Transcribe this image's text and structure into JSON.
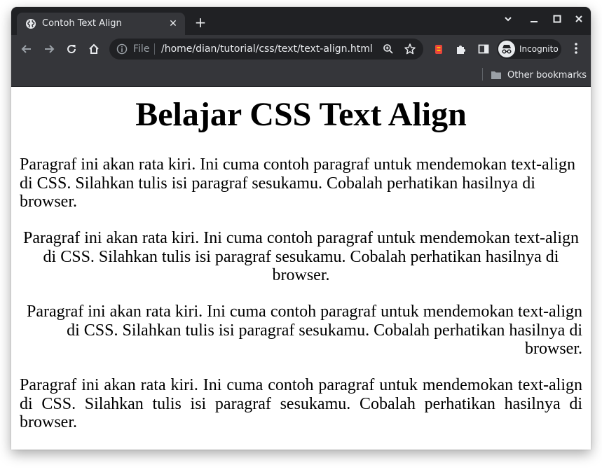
{
  "browser": {
    "tab": {
      "title": "Contoh Text Align",
      "favicon": "globe-icon"
    },
    "new_tab": "+",
    "window_controls": [
      "chevron-down-icon",
      "minimize-icon",
      "maximize-icon",
      "close-icon"
    ],
    "toolbar": {
      "scheme": "File",
      "url": "/home/dian/tutorial/css/text/text-align.html",
      "profile_label": "Incognito"
    },
    "bookmarks": {
      "other": "Other bookmarks"
    }
  },
  "page": {
    "heading": "Belajar CSS Text Align",
    "paragraphs": {
      "left": "Paragraf ini akan rata kiri. Ini cuma contoh paragraf untuk mendemokan text-align di CSS. Silahkan tulis isi paragraf sesukamu. Cobalah perhatikan hasilnya di browser.",
      "center": "Paragraf ini akan rata kiri. Ini cuma contoh paragraf untuk mendemokan text-align di CSS. Silahkan tulis isi paragraf sesukamu. Cobalah perhatikan hasilnya di browser.",
      "right": "Paragraf ini akan rata kiri. Ini cuma contoh paragraf untuk mendemokan text-align di CSS. Silahkan tulis isi paragraf sesukamu. Cobalah perhatikan hasilnya di browser.",
      "justify": "Paragraf ini akan rata kiri. Ini cuma contoh paragraf untuk mendemokan text-align di CSS. Silahkan tulis isi paragraf sesukamu. Cobalah perhatikan hasilnya di browser."
    }
  },
  "colors": {
    "tabstrip_bg": "#202124",
    "toolbar_bg": "#35363a",
    "text_light": "#e8eaed",
    "icon_dim": "#9aa0a6"
  }
}
